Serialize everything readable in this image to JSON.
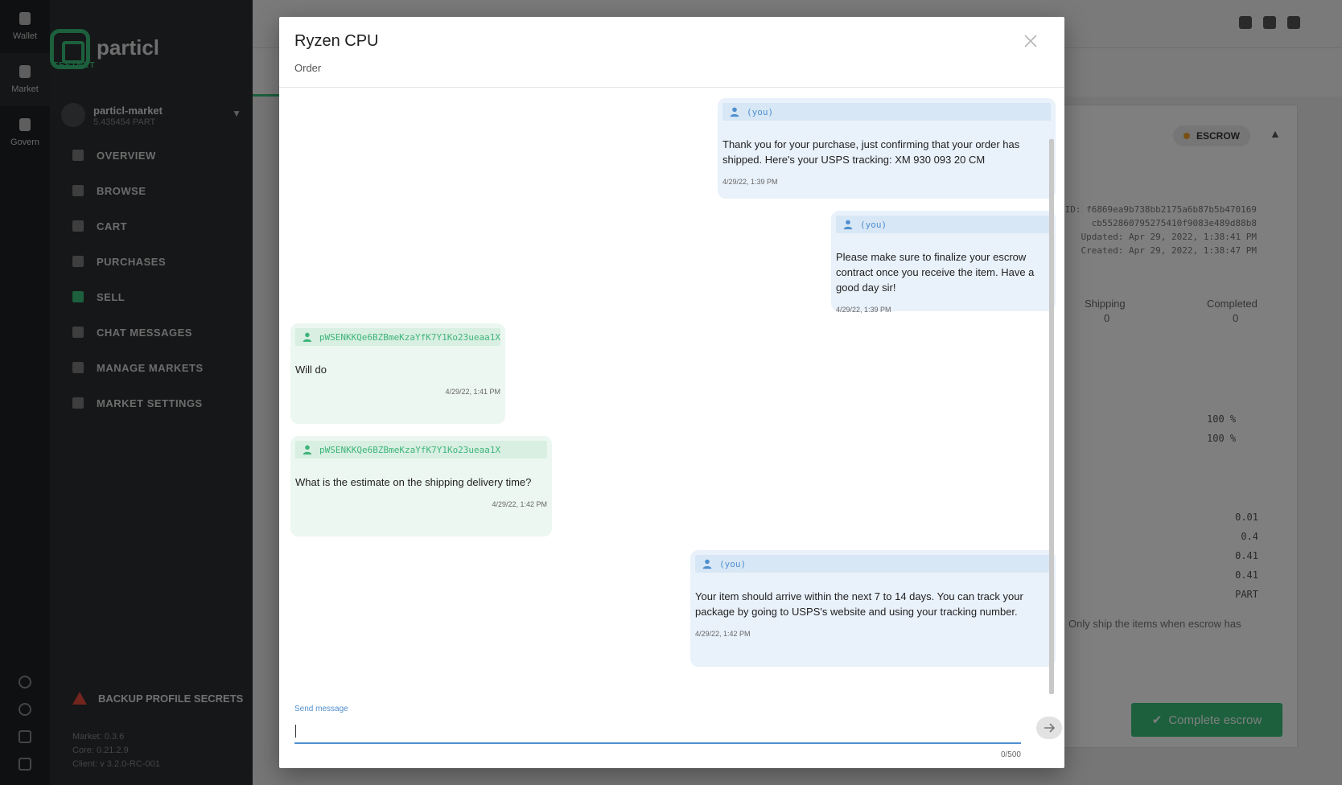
{
  "app": {
    "rail": [
      {
        "label": "Wallet",
        "icon": "wallet-icon"
      },
      {
        "label": "Market",
        "icon": "market-icon"
      },
      {
        "label": "Govern",
        "icon": "govern-icon"
      }
    ],
    "logo_text": "particl",
    "testnet_label": "TESTNET",
    "profile": {
      "name": "particl-market",
      "balance": "5.435454 PART"
    },
    "nav": [
      "OVERVIEW",
      "BROWSE",
      "CART",
      "PURCHASES",
      "SELL",
      "CHAT MESSAGES",
      "MANAGE MARKETS",
      "MARKET SETTINGS"
    ],
    "backup_label": "BACKUP PROFILE SECRETS",
    "versions": [
      "Market: 0.3.6",
      "Core: 0.21.2.9",
      "Client: v 3.2.0-RC-001"
    ],
    "order_card": {
      "status": "ESCROW",
      "ids": [
        "ID: f6869ea9b738bb2175a6b87b5b470169",
        "cb552860795275410f9083e489d88b8",
        "Updated: Apr 29, 2022, 1:38:41 PM",
        "Created: Apr 29, 2022, 1:38:47 PM"
      ],
      "stage_heads": [
        "Shipping",
        "Completed"
      ],
      "stage_counts": [
        "0",
        "0"
      ],
      "percents": [
        "100 %",
        "100 %"
      ],
      "amounts": [
        "0.01",
        "0.4",
        "0.41",
        "0.41",
        "PART"
      ],
      "note": "Only ship the items when escrow has",
      "complete_label": "Complete escrow"
    }
  },
  "modal": {
    "title": "Ryzen CPU",
    "subtitle": "Order",
    "messages": [
      {
        "author": "(you)",
        "mine": true,
        "text": "Thank you for your purchase, just confirming that your order has shipped. Here's your USPS tracking: XM 930 093 20 CM",
        "time": "4/29/22, 1:39 PM"
      },
      {
        "author": "(you)",
        "mine": true,
        "text": "Please make sure to finalize your escrow contract once you receive the item. Have a good day sir!",
        "time": "4/29/22, 1:39 PM"
      },
      {
        "author": "pWSENKKQe6BZBmeKzaYfK7Y1Ko23ueaa1X",
        "mine": false,
        "text": "Will do",
        "time": "4/29/22, 1:41 PM"
      },
      {
        "author": "pWSENKKQe6BZBmeKzaYfK7Y1Ko23ueaa1X",
        "mine": false,
        "text": "What is the estimate on the shipping delivery time?",
        "time": "4/29/22, 1:42 PM"
      },
      {
        "author": "(you)",
        "mine": true,
        "text": "Your item should arrive within the next 7 to 14 days. You can track your package by going to USPS's website and using your tracking number.",
        "time": "4/29/22, 1:42 PM"
      }
    ],
    "composer": {
      "label": "Send message",
      "value": "",
      "counter": "0/500"
    }
  },
  "colors": {
    "accent_blue": "#4f8fcf",
    "accent_green": "#39c07a",
    "mine_bg": "#e9f1fa",
    "theirs_bg": "#ecf7f1"
  }
}
